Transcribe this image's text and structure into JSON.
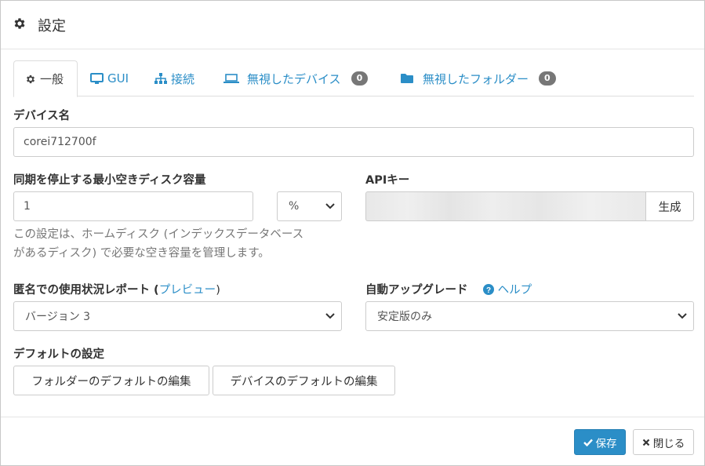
{
  "modal": {
    "title": "設定",
    "icon": "gear-icon"
  },
  "tabs": [
    {
      "label": "一般",
      "icon": "gear-icon",
      "active": true
    },
    {
      "label": "GUI",
      "icon": "monitor-icon"
    },
    {
      "label": "接続",
      "icon": "sitemap-icon"
    },
    {
      "label": "無視したデバイス",
      "icon": "laptop-icon",
      "badge": "0"
    },
    {
      "label": "無視したフォルダー",
      "icon": "folder-icon",
      "badge": "0"
    }
  ],
  "device_name": {
    "label": "デバイス名",
    "value": "corei712700f"
  },
  "min_disk": {
    "label": "同期を停止する最小空きディスク容量",
    "value": "1",
    "unit": "%",
    "help_line1": "この設定は、ホームディスク (インデックスデータベース",
    "help_line2": "があるディスク) で必要な空き容量を管理します。"
  },
  "api_key": {
    "label": "APIキー",
    "generate_label": "生成"
  },
  "usage_report": {
    "label": "匿名での使用状況レポート (",
    "preview_link": "プレビュー",
    "label_end": ")",
    "value": "バージョン 3"
  },
  "auto_upgrade": {
    "label": "自動アップグレード",
    "help_link": "ヘルプ",
    "value": "安定版のみ"
  },
  "defaults": {
    "label": "デフォルトの設定",
    "folder_button": "フォルダーのデフォルトの編集",
    "device_button": "デバイスのデフォルトの編集"
  },
  "footer": {
    "save_label": "保存",
    "close_label": "閉じる"
  },
  "colors": {
    "accent": "#2b8ec7",
    "badge": "#777777"
  }
}
